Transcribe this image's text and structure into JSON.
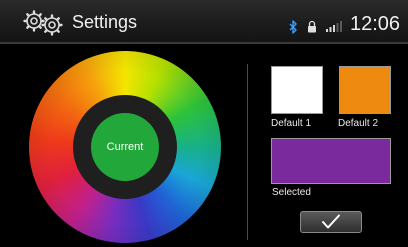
{
  "status_bar": {
    "title": "Settings",
    "time": "12:06",
    "icons": [
      "gear-icon",
      "bluetooth-icon",
      "lock-icon",
      "signal-icon"
    ]
  },
  "color_picker": {
    "current_label": "Current",
    "current_color": "#22a83a"
  },
  "presets": {
    "default1": {
      "label": "Default 1",
      "color": "#ffffff"
    },
    "default2": {
      "label": "Default 2",
      "color": "#ee8a10"
    },
    "selected": {
      "label": "Selected",
      "color": "#7a2a9c"
    }
  },
  "confirm": {
    "icon": "check-icon"
  }
}
